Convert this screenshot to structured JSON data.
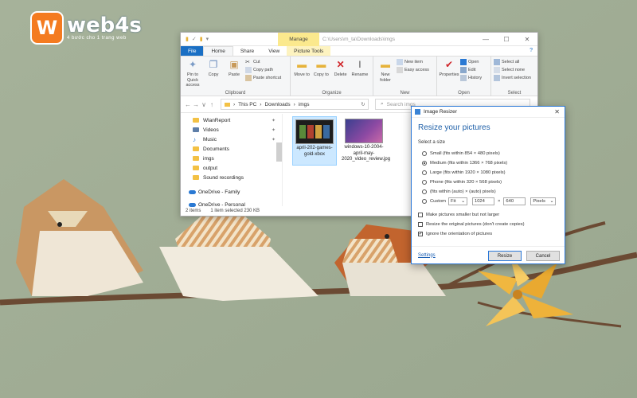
{
  "logo": {
    "badge_letter": "W",
    "name": "web4s",
    "tagline": "4 bước cho 1 trang web",
    "color": "#f47b20"
  },
  "explorer": {
    "qat_items": [
      "▮",
      "✓",
      "▮",
      "▾"
    ],
    "manage_tab": "Manage",
    "title_path": "C:\\Users\\m_ta\\Downloads\\imgs",
    "window_controls": [
      "—",
      "☐",
      "✕"
    ],
    "tabs": [
      {
        "label": "File",
        "style": "file"
      },
      {
        "label": "Home",
        "style": "active"
      },
      {
        "label": "Share",
        "style": ""
      },
      {
        "label": "View",
        "style": ""
      },
      {
        "label": "Picture Tools",
        "style": "picture"
      }
    ],
    "help_icon": "?",
    "ribbon": {
      "clipboard": {
        "label": "Clipboard",
        "pin": "Pin to Quick access",
        "copy": "Copy",
        "paste": "Paste",
        "cut": "Cut",
        "copy_path": "Copy path",
        "paste_shortcut": "Paste shortcut"
      },
      "organize": {
        "label": "Organize",
        "move_to": "Move to",
        "copy_to": "Copy to",
        "delete": "Delete",
        "rename": "Rename"
      },
      "new": {
        "label": "New",
        "new_folder": "New folder",
        "new_item": "New item",
        "easy_access": "Easy access"
      },
      "open": {
        "label": "Open",
        "properties": "Properties",
        "open": "Open",
        "edit": "Edit",
        "history": "History"
      },
      "select": {
        "label": "Select",
        "select_all": "Select all",
        "select_none": "Select none",
        "invert": "Invert selection"
      }
    },
    "nav_buttons": [
      "←",
      "→",
      "∨",
      "↑"
    ],
    "address": {
      "crumbs": [
        "This PC",
        "Downloads",
        "imgs"
      ],
      "separator": "›"
    },
    "search_placeholder": "Search imgs",
    "nav_items": [
      {
        "label": "WlanReport",
        "pinned": true
      },
      {
        "label": "Videos",
        "pinned": true
      },
      {
        "label": "Music",
        "pinned": true
      },
      {
        "label": "Documents",
        "pinned": false
      },
      {
        "label": "imgs",
        "pinned": false
      },
      {
        "label": "output",
        "pinned": false
      },
      {
        "label": "Sound recordings",
        "pinned": false
      }
    ],
    "onedrive_items": [
      "OneDrive - Family",
      "OneDrive - Personal"
    ],
    "files": [
      {
        "name": "april-202-games-gold-xbox",
        "selected": true
      },
      {
        "name": "windows-10-2004-april-may-2020_video_review.jpg",
        "selected": false
      }
    ],
    "status": {
      "items": "2 items",
      "selected": "1 item selected  230 KB"
    }
  },
  "dialog": {
    "title": "Image Resizer",
    "heading": "Resize your pictures",
    "select_size": "Select a size",
    "sizes": [
      {
        "label": "Small (fits within 854 × 480 pixels)",
        "checked": false
      },
      {
        "label": "Medium (fits within 1366 × 768 pixels)",
        "checked": true
      },
      {
        "label": "Large (fits within 1920 × 1080 pixels)",
        "checked": false
      },
      {
        "label": "Phone (fits within 320 × 568 pixels)",
        "checked": false
      },
      {
        "label": "(fits within (auto) × (auto) pixels)",
        "checked": false
      }
    ],
    "custom": {
      "label": "Custom",
      "fit": "Fit",
      "width": "1024",
      "x": "×",
      "height": "640",
      "unit": "Pixels"
    },
    "options": [
      {
        "label": "Make pictures smaller but not larger",
        "checked": false
      },
      {
        "label": "Resize the original pictures (don't create copies)",
        "checked": false
      },
      {
        "label": "Ignore the orientation of pictures",
        "checked": true
      }
    ],
    "settings_link": "Settings",
    "resize_button": "Resize",
    "cancel_button": "Cancel"
  }
}
